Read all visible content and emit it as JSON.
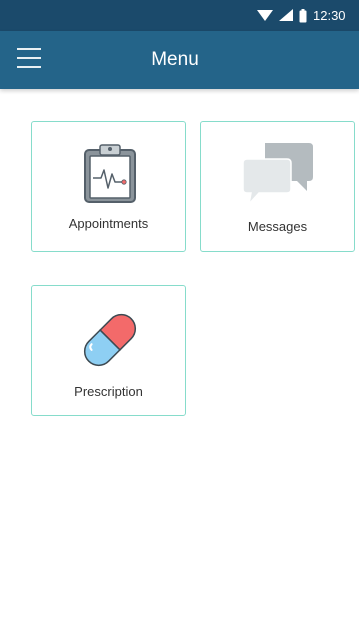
{
  "status_bar": {
    "time": "12:30",
    "icons": [
      "wifi-icon",
      "cell-signal-icon",
      "battery-icon"
    ]
  },
  "app_bar": {
    "title": "Menu",
    "menu_icon": "hamburger-menu-icon"
  },
  "tiles": [
    {
      "label": "Appointments",
      "icon": "clipboard-ecg-icon"
    },
    {
      "label": "Messages",
      "icon": "chat-bubbles-icon"
    },
    {
      "label": "Prescription",
      "icon": "pill-capsule-icon"
    }
  ],
  "colors": {
    "status_bar": "#1b4a6b",
    "app_bar": "#246489",
    "tile_border": "#86dccb",
    "pill_red": "#f36a6a",
    "pill_blue": "#8ecff3"
  }
}
